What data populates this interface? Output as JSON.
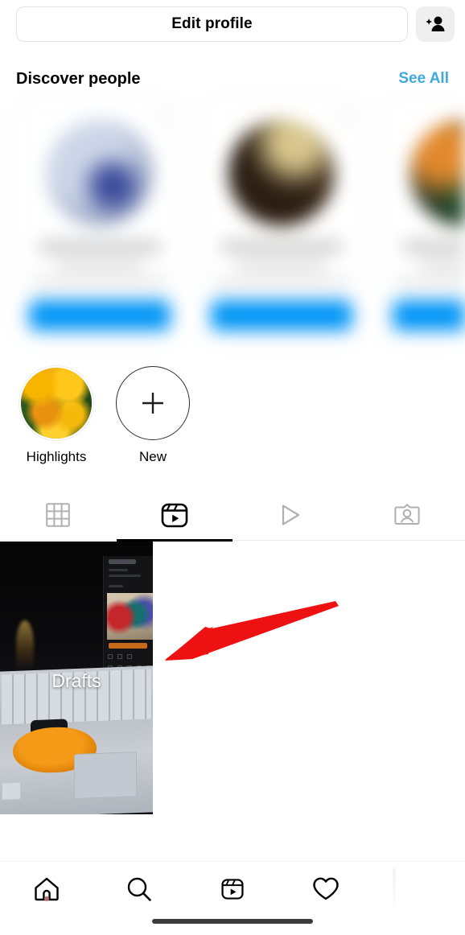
{
  "header": {
    "edit_profile_label": "Edit profile",
    "add_person_icon": "person-add-icon"
  },
  "discover": {
    "title": "Discover people",
    "see_all_label": "See All",
    "see_all_color": "#3fa9dd",
    "follow_button_color": "#0095f6",
    "blurred": true,
    "cards": [
      {
        "avatar_style": "a1",
        "redacted": true
      },
      {
        "avatar_style": "a2",
        "redacted": true
      },
      {
        "avatar_style": "a3",
        "redacted": true
      }
    ]
  },
  "highlights": {
    "items": [
      {
        "label": "Highlights",
        "thumb": "marigold-flowers"
      },
      {
        "label": "New",
        "thumb": "plus-icon"
      }
    ]
  },
  "tabs": [
    {
      "name": "grid",
      "icon": "grid-icon",
      "active": false
    },
    {
      "name": "reels",
      "icon": "reels-icon",
      "active": true
    },
    {
      "name": "video",
      "icon": "play-icon",
      "active": false
    },
    {
      "name": "tagged",
      "icon": "tagged-person-icon",
      "active": false
    }
  ],
  "grid": {
    "drafts_label": "Drafts",
    "thumbnail": "laptop-keyboard-photo"
  },
  "annotation": {
    "arrow_color": "#ee1111",
    "direction": "left",
    "points_to": "Drafts"
  },
  "bottom_nav": [
    {
      "name": "home",
      "icon": "home-icon",
      "badge_dot": true
    },
    {
      "name": "search",
      "icon": "search-icon",
      "badge_dot": false
    },
    {
      "name": "reels",
      "icon": "reels-icon",
      "badge_dot": false
    },
    {
      "name": "activity",
      "icon": "heart-icon",
      "badge_dot": false
    }
  ]
}
